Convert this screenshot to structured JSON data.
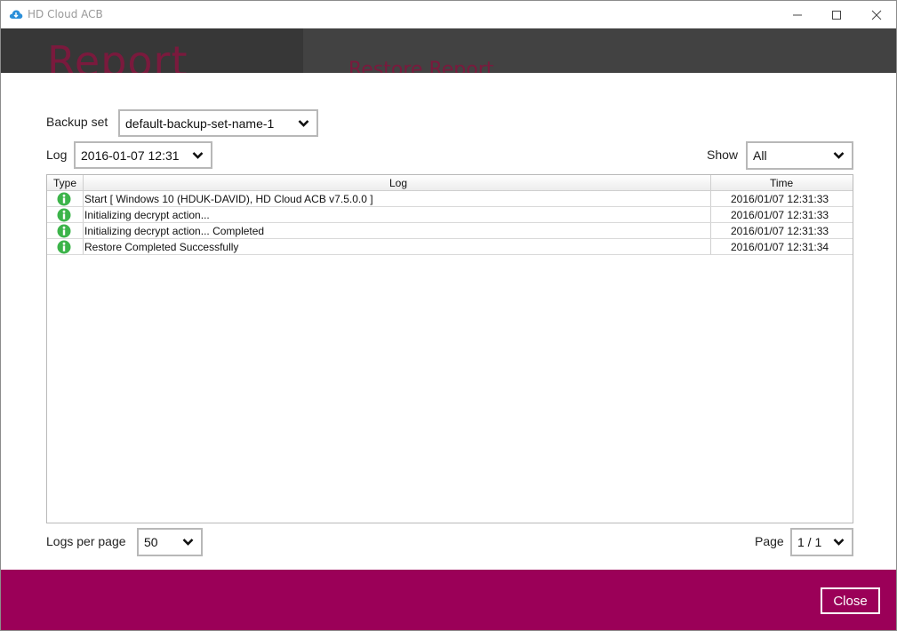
{
  "window": {
    "title": "HD Cloud ACB"
  },
  "background": {
    "heading": "Report",
    "subheading": "Restore Report"
  },
  "filters": {
    "backup_set_label": "Backup set",
    "backup_set_value": "default-backup-set-name-1",
    "log_label": "Log",
    "log_value": "2016-01-07 12:31",
    "show_label": "Show",
    "show_value": "All"
  },
  "table": {
    "columns": [
      "Type",
      "Log",
      "Time"
    ],
    "rows": [
      {
        "type": "info-icon",
        "log": "Start [ Windows 10 (HDUK-DAVID), HD Cloud ACB v7.5.0.0 ]",
        "time": "2016/01/07 12:31:33"
      },
      {
        "type": "info-icon",
        "log": "Initializing decrypt action...",
        "time": "2016/01/07 12:31:33"
      },
      {
        "type": "info-icon",
        "log": "Initializing decrypt action... Completed",
        "time": "2016/01/07 12:31:33"
      },
      {
        "type": "info-icon",
        "log": "Restore Completed Successfully",
        "time": "2016/01/07 12:31:34"
      }
    ]
  },
  "pagination": {
    "logs_per_page_label": "Logs per page",
    "logs_per_page_value": "50",
    "page_label": "Page",
    "page_value": "1 / 1"
  },
  "footer": {
    "close_label": "Close"
  },
  "colors": {
    "accent": "#9b0058",
    "info_icon": "#3cb44a"
  }
}
